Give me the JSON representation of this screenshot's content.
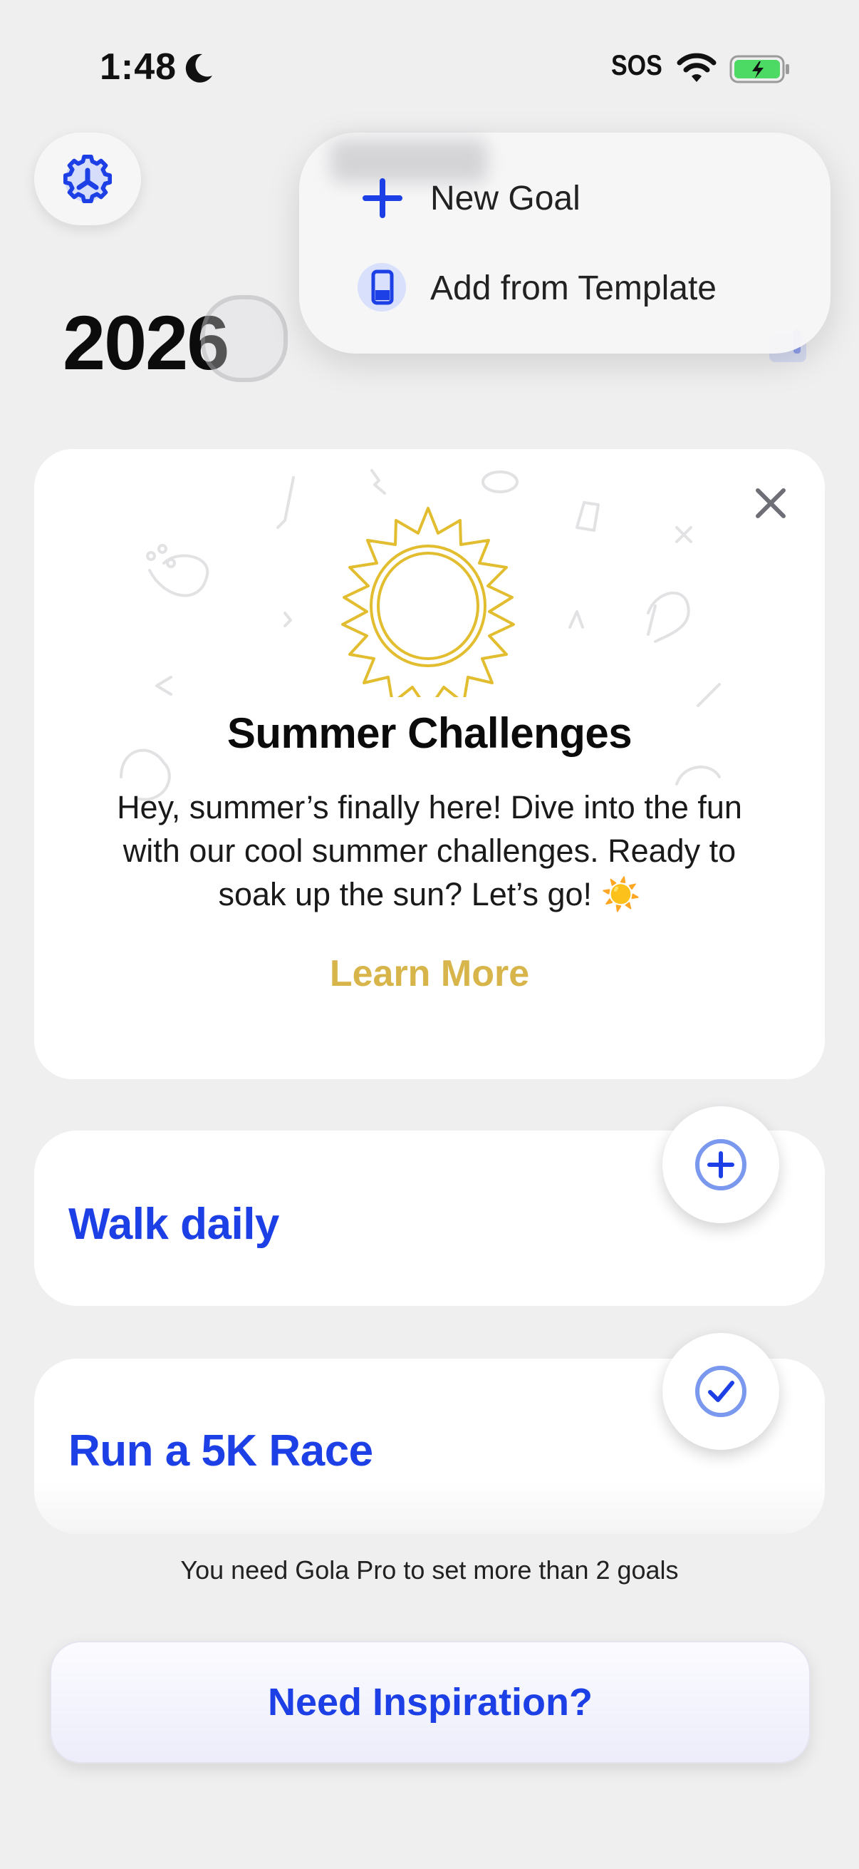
{
  "status_bar": {
    "time": "1:48",
    "sos": "SOS",
    "icons": [
      "moon-icon",
      "wifi-icon",
      "battery-charging-icon"
    ]
  },
  "header": {
    "year": "2026",
    "settings_icon": "gear-icon"
  },
  "menu": {
    "items": [
      {
        "label": "New Goal",
        "icon": "plus-icon"
      },
      {
        "label": "Add from Template",
        "icon": "template-icon"
      }
    ]
  },
  "promo": {
    "title": "Summer Challenges",
    "body": "Hey, summer’s finally here! Dive into the fun with our cool summer challenges. Ready to soak up the sun? Let’s go! ☀️",
    "cta": "Learn More",
    "close_icon": "close-icon",
    "accent_color": "#d7b54a"
  },
  "goals": [
    {
      "title": "Walk daily",
      "action_icon": "plus-circle-icon"
    },
    {
      "title": "Run a 5K Race",
      "action_icon": "check-circle-icon"
    }
  ],
  "pro_note": "You need Gola Pro to set more than 2 goals",
  "inspiration_button": "Need Inspiration?",
  "colors": {
    "brand_blue": "#1d3fe6",
    "background": "#efeff0"
  }
}
